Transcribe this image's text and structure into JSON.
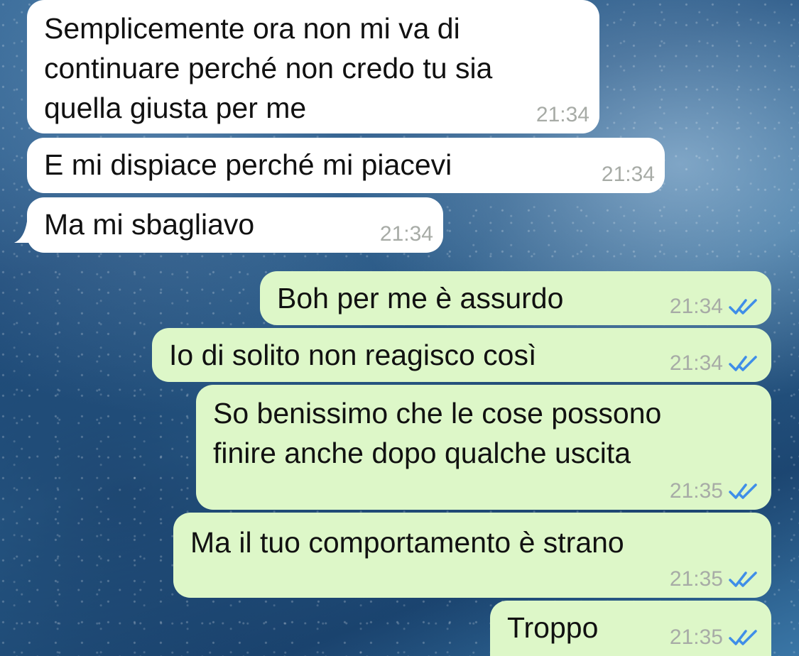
{
  "chat": {
    "messages": [
      {
        "direction": "incoming",
        "text": "Semplicemente ora non mi va di\ncontinuare perché non credo tu sia\nquella giusta per me",
        "time": "21:34"
      },
      {
        "direction": "incoming",
        "text": "E mi dispiace perché mi piacevi",
        "time": "21:34"
      },
      {
        "direction": "incoming",
        "text": "Ma mi sbagliavo",
        "time": "21:34"
      },
      {
        "direction": "outgoing",
        "text": "Boh per me è assurdo",
        "time": "21:34",
        "status": "read"
      },
      {
        "direction": "outgoing",
        "text": "Io di solito non reagisco così",
        "time": "21:34",
        "status": "read"
      },
      {
        "direction": "outgoing",
        "text": "So benissimo che le cose possono\nfinire anche dopo qualche uscita",
        "time": "21:35",
        "status": "read"
      },
      {
        "direction": "outgoing",
        "text": "Ma il tuo comportamento è strano",
        "time": "21:35",
        "status": "read"
      },
      {
        "direction": "outgoing",
        "text": "Troppo",
        "time": "21:35",
        "status": "read"
      }
    ]
  },
  "colors": {
    "incoming_bubble": "#ffffff",
    "outgoing_bubble": "#ddf7c8",
    "read_ticks": "#3f8ee8",
    "timestamp": "#a7aba6"
  },
  "icons": {
    "read_receipt": "double-check-icon"
  }
}
